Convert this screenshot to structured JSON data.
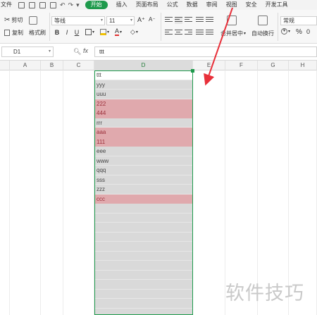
{
  "menubar": {
    "items": [
      "文件",
      "开始",
      "插入",
      "页面布局",
      "公式",
      "数据",
      "审阅",
      "视图",
      "安全",
      "开发工具"
    ]
  },
  "ribbon": {
    "cut_label": "剪切",
    "copy_label": "复制",
    "format_painter_label": "格式刷",
    "font_name": "等线",
    "font_size": "11",
    "bold": "B",
    "italic": "I",
    "underline": "U",
    "font_color": "A",
    "merge_center_label": "合并居中",
    "wrap_text_label": "自动换行",
    "number_format": "常规",
    "percent": "%",
    "thousands": "0"
  },
  "formula_bar": {
    "name_box": "D1",
    "fx_label": "fx",
    "content": "ttt"
  },
  "columns": [
    "A",
    "B",
    "C",
    "D",
    "E",
    "F",
    "G",
    "H"
  ],
  "selected_column": "D",
  "column_d_cells": [
    {
      "text": "ttt",
      "highlight": false
    },
    {
      "text": "yyy",
      "highlight": false
    },
    {
      "text": "uuu",
      "highlight": false
    },
    {
      "text": "222",
      "highlight": true
    },
    {
      "text": "444",
      "highlight": true
    },
    {
      "text": "rrr",
      "highlight": false
    },
    {
      "text": "aaa",
      "highlight": true
    },
    {
      "text": "111",
      "highlight": true
    },
    {
      "text": "eee",
      "highlight": false
    },
    {
      "text": "www",
      "highlight": false
    },
    {
      "text": "qqq",
      "highlight": false
    },
    {
      "text": "sss",
      "highlight": false
    },
    {
      "text": "zzz",
      "highlight": false
    },
    {
      "text": "ccc",
      "highlight": true
    }
  ],
  "colors": {
    "accent_green": "#1e9a4c",
    "duplicate_fill": "#e0a9ad",
    "duplicate_text": "#9b2f3a",
    "selection_fill": "#d9d9d9",
    "annotation_arrow": "#e8303a"
  },
  "watermark": "软件技巧"
}
